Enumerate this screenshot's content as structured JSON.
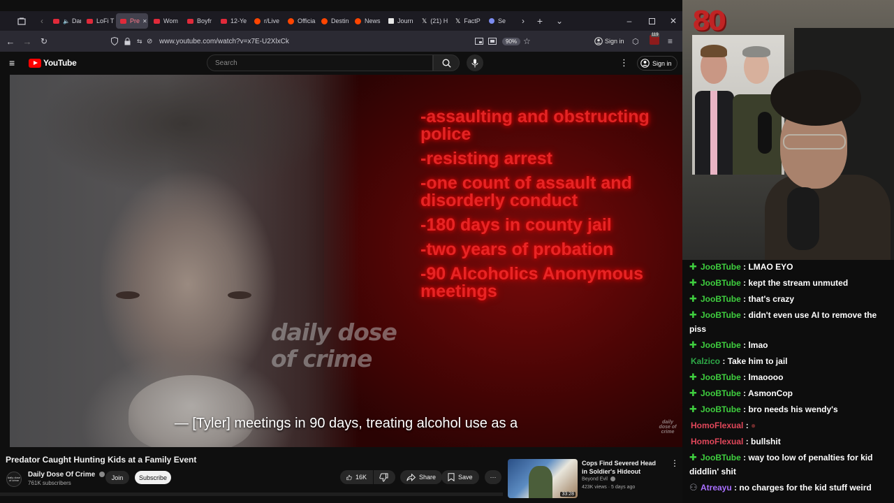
{
  "browser": {
    "tabs": [
      {
        "label": "Dark S",
        "favicon": "youtube",
        "audio": true
      },
      {
        "label": "LoFi T",
        "favicon": "youtube"
      },
      {
        "label": "Pre",
        "favicon": "youtube",
        "active": true
      },
      {
        "label": "Wom",
        "favicon": "youtube"
      },
      {
        "label": "Boyfr",
        "favicon": "youtube"
      },
      {
        "label": "12-Ye",
        "favicon": "youtube"
      },
      {
        "label": "r/Live",
        "favicon": "reddit"
      },
      {
        "label": "Officia",
        "favicon": "reddit"
      },
      {
        "label": "Destin",
        "favicon": "reddit"
      },
      {
        "label": "News",
        "favicon": "reddit"
      },
      {
        "label": "Journ",
        "favicon": "journal"
      },
      {
        "label": "(21) H",
        "favicon": "x"
      },
      {
        "label": "FactP",
        "favicon": "x"
      },
      {
        "label": "Se",
        "favicon": "generic"
      }
    ],
    "url": "www.youtube.com/watch?v=x7E-U2XlxCk",
    "zoom": "90%",
    "sign_in": "Sign in",
    "badge_count": "119"
  },
  "youtube": {
    "logo_text": "YouTube",
    "search_placeholder": "Search",
    "sign_in": "Sign in",
    "video": {
      "red_text": [
        "-assaulting and obstructing police",
        "-resisting arrest",
        "-one count of assault and disorderly conduct",
        "-180 days in county jail",
        "-two years of probation",
        "-90 Alcoholics Anonymous meetings"
      ],
      "watermark": "daily dose of crime",
      "watermark_small": "daily dose of crime",
      "subtitle": "— [Tyler] meetings in 90 days, treating alcohol use as a"
    },
    "title": "Predator Caught Hunting Kids at a Family Event",
    "channel": {
      "avatar_text": "daily dose of crime",
      "name": "Daily Dose Of Crime",
      "subscribers": "761K subscribers",
      "join": "Join",
      "subscribe": "Subscribe"
    },
    "actions": {
      "likes": "16K",
      "share": "Share",
      "save": "Save",
      "more": "···"
    },
    "recommendation": {
      "title": "Cops Find Severed Head in Soldier's Hideout",
      "channel": "Beyond Evil",
      "views": "423K views · 5 days ago",
      "duration": "33:28"
    }
  },
  "stream": {
    "logo": "80",
    "chat": [
      {
        "user": "JooBTube",
        "color": "#3fcf3f",
        "badge": true,
        "text": "LMAO EYO"
      },
      {
        "user": "JooBTube",
        "color": "#3fcf3f",
        "badge": true,
        "text": "kept the stream unmuted"
      },
      {
        "user": "JooBTube",
        "color": "#3fcf3f",
        "badge": true,
        "text": "that's crazy"
      },
      {
        "user": "JooBTube",
        "color": "#3fcf3f",
        "badge": true,
        "text": "didn't even use AI to remove the piss"
      },
      {
        "user": "JooBTube",
        "color": "#3fcf3f",
        "badge": true,
        "text": "lmao"
      },
      {
        "user": "Kalzico",
        "color": "#2eaa48",
        "badge": false,
        "text": "Take him to jail"
      },
      {
        "user": "JooBTube",
        "color": "#3fcf3f",
        "badge": true,
        "text": "lmaoooo"
      },
      {
        "user": "JooBTube",
        "color": "#3fcf3f",
        "badge": true,
        "text": "AsmonCop"
      },
      {
        "user": "JooBTube",
        "color": "#3fcf3f",
        "badge": true,
        "text": "bro needs his wendy's"
      },
      {
        "user": "HomoFlexual",
        "color": "#e0475a",
        "badge": false,
        "text": "●",
        "emote": true
      },
      {
        "user": "HomoFlexual",
        "color": "#e0475a",
        "badge": false,
        "text": "bullshit"
      },
      {
        "user": "JooBTube",
        "color": "#3fcf3f",
        "badge": true,
        "text": "way too low of penalties for kid diddlin' shit"
      },
      {
        "user": "Atreayu",
        "color": "#a970ff",
        "badge": false,
        "text": "no charges for the kid stuff weird",
        "icon": true
      }
    ]
  }
}
